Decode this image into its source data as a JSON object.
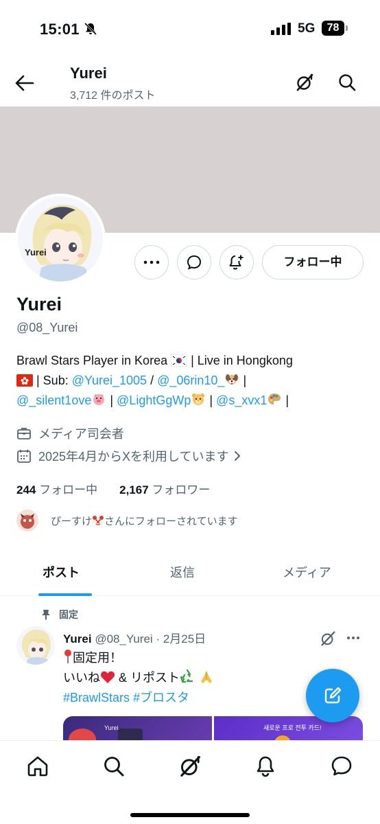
{
  "status_bar": {
    "time": "15:01",
    "network": "5G",
    "battery": "78"
  },
  "header": {
    "title": "Yurei",
    "post_count": "3,712 件のポスト"
  },
  "profile": {
    "avatar_label": "Yurei",
    "display_name": "Yurei",
    "handle": "@08_Yurei",
    "follow_button": "フォロー中",
    "bio": {
      "line1_text": "Brawl Stars Player in Korea ",
      "line1_rest": " | Live in Hongkong",
      "line2_sep1": " | Sub: ",
      "mention1": "@Yurei_1005",
      "slash": " / ",
      "mention2": "@_06rin10_",
      "pipe": " |",
      "mention3": "@_silent1ove",
      "pipe2": " | ",
      "mention4": "@LightGgWp",
      "pipe3": " | ",
      "mention5": "@s_xvx1",
      "pipe4": " |"
    },
    "profession": "メディア司会者",
    "joined": "2025年4月からXを利用しています",
    "following_count": "244",
    "following_label": "フォロー中",
    "followers_count": "2,167",
    "followers_label": "フォロワー",
    "followed_by_name": "ぴーすけ",
    "followed_by_suffix": "さんにフォローされています"
  },
  "tabs": [
    {
      "label": "ポスト"
    },
    {
      "label": "返信"
    },
    {
      "label": "メディア"
    }
  ],
  "post": {
    "pinned_label": "固定",
    "author": "Yurei",
    "handle": "@08_Yurei",
    "separator": " · ",
    "date": "2月25日",
    "line1": "固定用！",
    "line2_a": "いいね",
    "line2_b": " & リポスト",
    "hashtags": "#BrawlStars #ブロスタ",
    "image_text_left": "Yurei",
    "image_text_right": "새로운 프로 전투 카드!"
  },
  "colors": {
    "accent": "#1d9bf0",
    "muted": "#536471",
    "text": "#0f1419",
    "banner": "#d7d1d1"
  },
  "icons": [
    "back-arrow-icon",
    "grok-icon",
    "search-icon",
    "more-icon",
    "message-icon",
    "notification-add-icon",
    "briefcase-icon",
    "calendar-icon",
    "chevron-right-icon",
    "pin-icon",
    "compose-icon",
    "home-icon",
    "bell-icon"
  ]
}
